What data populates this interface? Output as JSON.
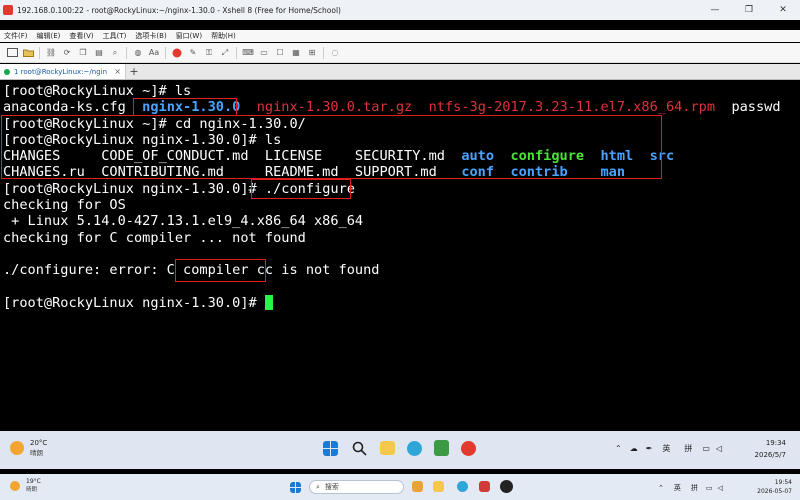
{
  "window": {
    "title": "192.168.0.100:22 - root@RockyLinux:~/nginx-1.30.0 - Xshell 8 (Free for Home/School)",
    "controls": [
      "—",
      "❐",
      "✕"
    ]
  },
  "menubar": {
    "items": [
      "文件(F)",
      "编辑(E)",
      "查看(V)",
      "工具(T)",
      "选项卡(B)",
      "窗口(W)",
      "帮助(H)"
    ]
  },
  "tab": {
    "label": "1 root@RockyLinux:~/ngin",
    "close": "×",
    "add": "+"
  },
  "terminal": {
    "lines": [
      {
        "p": "[root@RockyLinux ~]# ",
        "c": "ls"
      },
      {
        "f1": "anaconda-ks.cfg  ",
        "d1": "nginx-1.30.0",
        "sp": "  ",
        "r1": "nginx-1.30.0.tar.gz",
        "sp2": "  ",
        "r2": "ntfs-3g-2017.3.23-11.el7.x86_64.rpm",
        "sp3": "  ",
        "f2": "passwd"
      },
      {
        "p": "[root@RockyLinux ~]# ",
        "c": "cd nginx-1.30.0/"
      },
      {
        "p": "[root@RockyLinux nginx-1.30.0]# ",
        "c": "ls"
      },
      {
        "a": "CHANGES     CODE_OF_CONDUCT.md  LICENSE    SECURITY.md  ",
        "d1": "auto",
        "s1": "  ",
        "e1": "configure",
        "s2": "  ",
        "d2": "html",
        "s3": "  ",
        "d3": "src"
      },
      {
        "a": "CHANGES.ru  CONTRIBUTING.md     README.md  SUPPORT.md   ",
        "d1": "conf",
        "s1": "  ",
        "e1": "contrib",
        "s2": "    ",
        "d2": "man"
      },
      {
        "p": "[root@RockyLinux nginx-1.30.0]# ",
        "c": "./configure"
      },
      {
        "t": "checking for OS"
      },
      {
        "t": " + Linux 5.14.0-427.13.1.el9_4.x86_64 x86_64"
      },
      {
        "t": "checking for C compiler ... not found"
      },
      {
        "t": ""
      },
      {
        "t": "./configure: error: C compiler cc is not found"
      },
      {
        "t": ""
      },
      {
        "p": "[root@RockyLinux nginx-1.30.0]# ",
        "c": ""
      }
    ]
  },
  "colors": {
    "red": "#e0323a",
    "dir": "#4aa3ff",
    "exec": "#4de23a",
    "cursor": "#2bf24a",
    "annotation": "#e0201f"
  },
  "taskbar": {
    "weather": {
      "temp": "20°C",
      "desc": "晴朗"
    },
    "ime_lang": "英",
    "ime_mode": "拼",
    "time": "19:34",
    "date": "2026/5/7"
  },
  "taskbar2": {
    "weather": {
      "temp": "19°C",
      "desc": "晴朗"
    },
    "search_placeholder": "搜索",
    "ime_lang": "英",
    "ime_mode": "拼",
    "time": "19:54",
    "date": "2026-05-07"
  }
}
